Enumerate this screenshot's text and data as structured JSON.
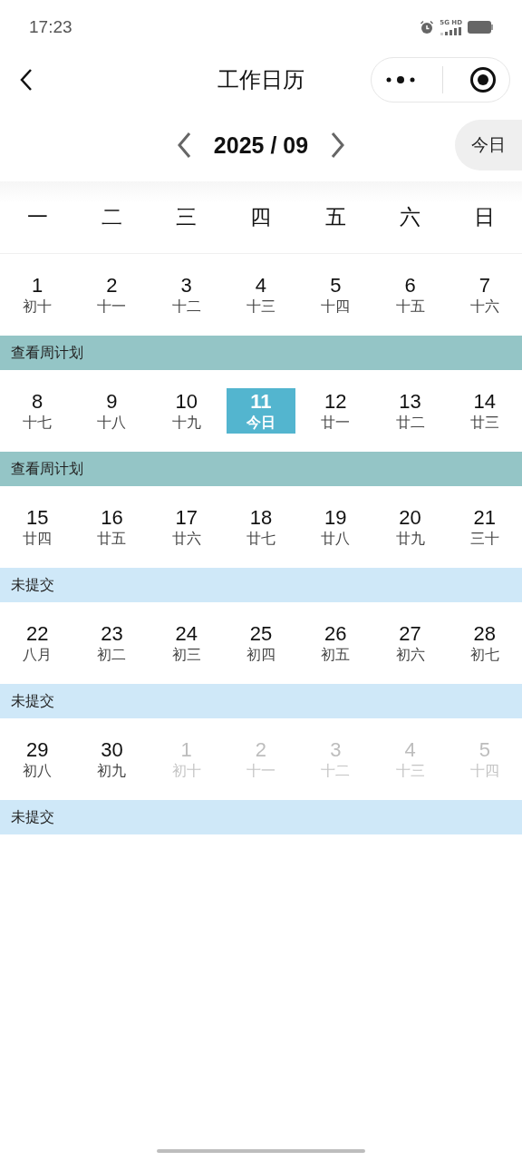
{
  "status_bar": {
    "time": "17:23",
    "network": "5G HD"
  },
  "nav": {
    "title": "工作日历"
  },
  "month": {
    "label": "2025 / 09",
    "today_button": "今日"
  },
  "weekdays": [
    "一",
    "二",
    "三",
    "四",
    "五",
    "六",
    "日"
  ],
  "weeks": [
    {
      "days": [
        {
          "date": "1",
          "lunar": "初十",
          "today": false,
          "other_month": false
        },
        {
          "date": "2",
          "lunar": "十一",
          "today": false,
          "other_month": false
        },
        {
          "date": "3",
          "lunar": "十二",
          "today": false,
          "other_month": false
        },
        {
          "date": "4",
          "lunar": "十三",
          "today": false,
          "other_month": false
        },
        {
          "date": "5",
          "lunar": "十四",
          "today": false,
          "other_month": false
        },
        {
          "date": "6",
          "lunar": "十五",
          "today": false,
          "other_month": false
        },
        {
          "date": "7",
          "lunar": "十六",
          "today": false,
          "other_month": false
        }
      ],
      "bar": {
        "kind": "plan",
        "label": "查看周计划"
      }
    },
    {
      "days": [
        {
          "date": "8",
          "lunar": "十七",
          "today": false,
          "other_month": false
        },
        {
          "date": "9",
          "lunar": "十八",
          "today": false,
          "other_month": false
        },
        {
          "date": "10",
          "lunar": "十九",
          "today": false,
          "other_month": false
        },
        {
          "date": "11",
          "lunar": "今日",
          "today": true,
          "other_month": false
        },
        {
          "date": "12",
          "lunar": "廿一",
          "today": false,
          "other_month": false
        },
        {
          "date": "13",
          "lunar": "廿二",
          "today": false,
          "other_month": false
        },
        {
          "date": "14",
          "lunar": "廿三",
          "today": false,
          "other_month": false
        }
      ],
      "bar": {
        "kind": "plan",
        "label": "查看周计划"
      }
    },
    {
      "days": [
        {
          "date": "15",
          "lunar": "廿四",
          "today": false,
          "other_month": false
        },
        {
          "date": "16",
          "lunar": "廿五",
          "today": false,
          "other_month": false
        },
        {
          "date": "17",
          "lunar": "廿六",
          "today": false,
          "other_month": false
        },
        {
          "date": "18",
          "lunar": "廿七",
          "today": false,
          "other_month": false
        },
        {
          "date": "19",
          "lunar": "廿八",
          "today": false,
          "other_month": false
        },
        {
          "date": "20",
          "lunar": "廿九",
          "today": false,
          "other_month": false
        },
        {
          "date": "21",
          "lunar": "三十",
          "today": false,
          "other_month": false
        }
      ],
      "bar": {
        "kind": "unsubmitted",
        "label": "未提交"
      }
    },
    {
      "days": [
        {
          "date": "22",
          "lunar": "八月",
          "today": false,
          "other_month": false
        },
        {
          "date": "23",
          "lunar": "初二",
          "today": false,
          "other_month": false
        },
        {
          "date": "24",
          "lunar": "初三",
          "today": false,
          "other_month": false
        },
        {
          "date": "25",
          "lunar": "初四",
          "today": false,
          "other_month": false
        },
        {
          "date": "26",
          "lunar": "初五",
          "today": false,
          "other_month": false
        },
        {
          "date": "27",
          "lunar": "初六",
          "today": false,
          "other_month": false
        },
        {
          "date": "28",
          "lunar": "初七",
          "today": false,
          "other_month": false
        }
      ],
      "bar": {
        "kind": "unsubmitted",
        "label": "未提交"
      }
    },
    {
      "days": [
        {
          "date": "29",
          "lunar": "初八",
          "today": false,
          "other_month": false
        },
        {
          "date": "30",
          "lunar": "初九",
          "today": false,
          "other_month": false
        },
        {
          "date": "1",
          "lunar": "初十",
          "today": false,
          "other_month": true
        },
        {
          "date": "2",
          "lunar": "十一",
          "today": false,
          "other_month": true
        },
        {
          "date": "3",
          "lunar": "十二",
          "today": false,
          "other_month": true
        },
        {
          "date": "4",
          "lunar": "十三",
          "today": false,
          "other_month": true
        },
        {
          "date": "5",
          "lunar": "十四",
          "today": false,
          "other_month": true
        }
      ],
      "bar": {
        "kind": "unsubmitted",
        "label": "未提交"
      }
    }
  ]
}
